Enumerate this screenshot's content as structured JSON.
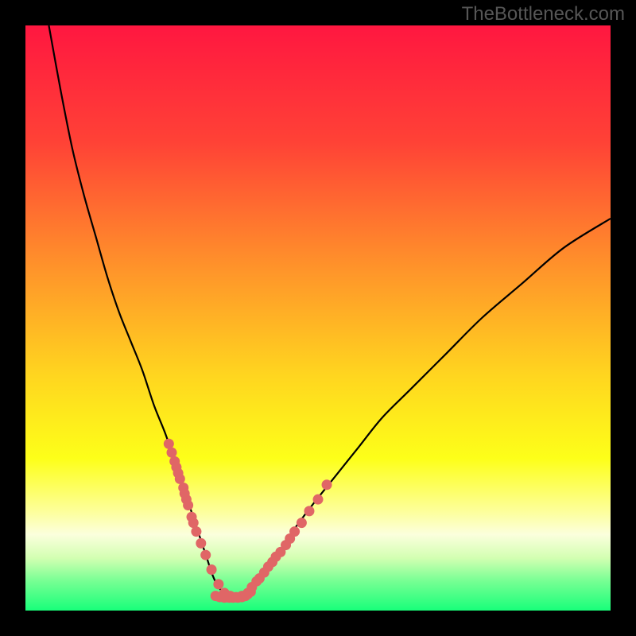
{
  "watermark": "TheBottleneck.com",
  "chart_data": {
    "type": "line",
    "title": "",
    "xlabel": "",
    "ylabel": "",
    "xlim": [
      0,
      100
    ],
    "ylim": [
      0,
      100
    ],
    "gradient_stops": [
      {
        "pos": 0.0,
        "color": "#ff1740"
      },
      {
        "pos": 0.2,
        "color": "#ff4236"
      },
      {
        "pos": 0.4,
        "color": "#ff8e2b"
      },
      {
        "pos": 0.6,
        "color": "#ffd61f"
      },
      {
        "pos": 0.74,
        "color": "#fdff19"
      },
      {
        "pos": 0.83,
        "color": "#fdff9a"
      },
      {
        "pos": 0.87,
        "color": "#fbffdd"
      },
      {
        "pos": 0.91,
        "color": "#d3ffb2"
      },
      {
        "pos": 0.95,
        "color": "#76ff93"
      },
      {
        "pos": 1.0,
        "color": "#18ff7a"
      }
    ],
    "series": [
      {
        "name": "bottleneck-curve",
        "color": "#000000",
        "x": [
          4,
          6,
          8,
          10,
          12,
          14,
          16,
          18,
          20,
          22,
          24,
          26,
          27,
          28,
          29,
          30,
          31,
          32,
          33,
          34,
          35,
          36,
          37,
          38,
          40,
          42,
          44,
          46,
          49,
          53,
          57,
          61,
          66,
          72,
          78,
          85,
          92,
          100
        ],
        "values": [
          100,
          89,
          79,
          71,
          64,
          57,
          51,
          46,
          41,
          35,
          30,
          24,
          21,
          18,
          15,
          12,
          9,
          6,
          4,
          3,
          2,
          2,
          2,
          3,
          5,
          8,
          11,
          14,
          18,
          23,
          28,
          33,
          38,
          44,
          50,
          56,
          62,
          67
        ]
      }
    ],
    "marker_series": [
      {
        "name": "left-cluster-markers",
        "color": "#e06666",
        "x": [
          24.5,
          25.0,
          25.5,
          25.8,
          26.1,
          26.4,
          27.0,
          27.2,
          27.5,
          27.8,
          28.4,
          28.7,
          29.2,
          30.0,
          30.8,
          31.8,
          33.0,
          34.0,
          35.0
        ],
        "values": [
          28.5,
          27.0,
          25.5,
          24.5,
          23.5,
          22.5,
          21.0,
          20.0,
          19.0,
          18.0,
          16.0,
          15.0,
          13.5,
          11.5,
          9.5,
          7.0,
          4.5,
          3.0,
          2.5
        ]
      },
      {
        "name": "right-cluster-markers",
        "color": "#e06666",
        "x": [
          36.0,
          37.0,
          38.0,
          38.7,
          39.5,
          40.0,
          40.8,
          41.5,
          42.2,
          42.8,
          43.6,
          44.5,
          45.2,
          46.0,
          47.2,
          48.5,
          50.0,
          51.5
        ],
        "values": [
          2.3,
          2.5,
          3.0,
          4.0,
          5.0,
          5.5,
          6.5,
          7.5,
          8.3,
          9.2,
          10.0,
          11.2,
          12.3,
          13.5,
          15.0,
          17.0,
          19.0,
          21.5
        ]
      },
      {
        "name": "bottom-band-markers",
        "color": "#e06666",
        "x": [
          32.5,
          33.2,
          34.0,
          34.8,
          35.5,
          36.3,
          37.0,
          37.6,
          38.0,
          38.5
        ],
        "values": [
          2.5,
          2.3,
          2.2,
          2.2,
          2.2,
          2.2,
          2.3,
          2.5,
          2.8,
          3.2
        ]
      }
    ],
    "marker_radius": 6.5
  }
}
